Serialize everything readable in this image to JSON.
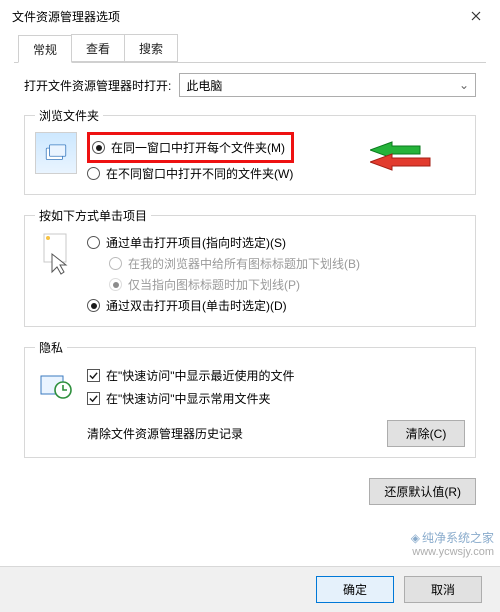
{
  "window": {
    "title": "文件资源管理器选项"
  },
  "tabs": [
    "常规",
    "查看",
    "搜索"
  ],
  "open_with": {
    "label": "打开文件资源管理器时打开:",
    "selected": "此电脑"
  },
  "browse": {
    "legend": "浏览文件夹",
    "opt_same": "在同一窗口中打开每个文件夹(M)",
    "opt_new": "在不同窗口中打开不同的文件夹(W)"
  },
  "click": {
    "legend": "按如下方式单击项目",
    "opt_single": "通过单击打开项目(指向时选定)(S)",
    "sub_browser": "在我的浏览器中给所有图标标题加下划线(B)",
    "sub_point": "仅当指向图标标题时加下划线(P)",
    "opt_double": "通过双击打开项目(单击时选定)(D)"
  },
  "privacy": {
    "legend": "隐私",
    "chk_recent": "在\"快速访问\"中显示最近使用的文件",
    "chk_freq": "在\"快速访问\"中显示常用文件夹",
    "clear_label": "清除文件资源管理器历史记录",
    "clear_btn": "清除(C)"
  },
  "restore_defaults": "还原默认值(R)",
  "footer": {
    "ok": "确定",
    "cancel": "取消"
  },
  "watermark": {
    "line1": "纯净系统之家",
    "line2": "www.ycwsjy.com"
  }
}
